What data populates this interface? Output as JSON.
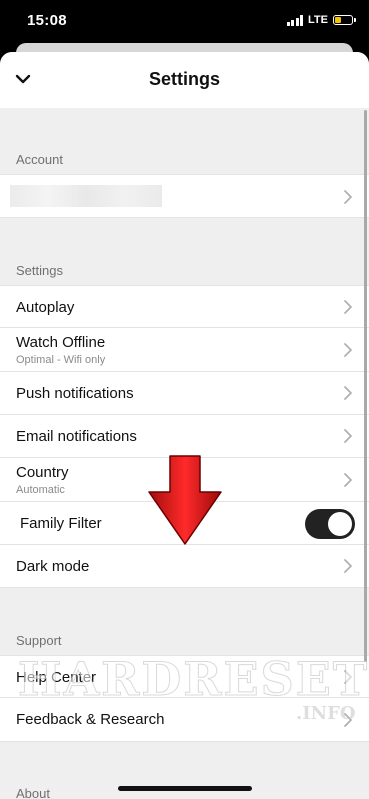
{
  "status": {
    "time": "15:08",
    "network": "LTE",
    "battery_level": 0.4
  },
  "header": {
    "title": "Settings"
  },
  "sections": {
    "account": {
      "title": "Account"
    },
    "settings": {
      "title": "Settings",
      "items": [
        {
          "label": "Autoplay"
        },
        {
          "label": "Watch Offline",
          "sub": "Optimal - Wifi only"
        },
        {
          "label": "Push notifications"
        },
        {
          "label": "Email notifications"
        },
        {
          "label": "Country",
          "sub": "Automatic"
        },
        {
          "label": "Family Filter",
          "toggle": true
        },
        {
          "label": "Dark mode"
        }
      ]
    },
    "support": {
      "title": "Support",
      "items": [
        {
          "label": "Help Center"
        },
        {
          "label": "Feedback & Research"
        }
      ]
    },
    "about": {
      "title": "About"
    }
  },
  "watermark": {
    "main": "HARDRESET",
    "sub": ".INFO"
  },
  "colors": {
    "toggle_on": "#222222",
    "arrow_red": "#d81c1c"
  }
}
